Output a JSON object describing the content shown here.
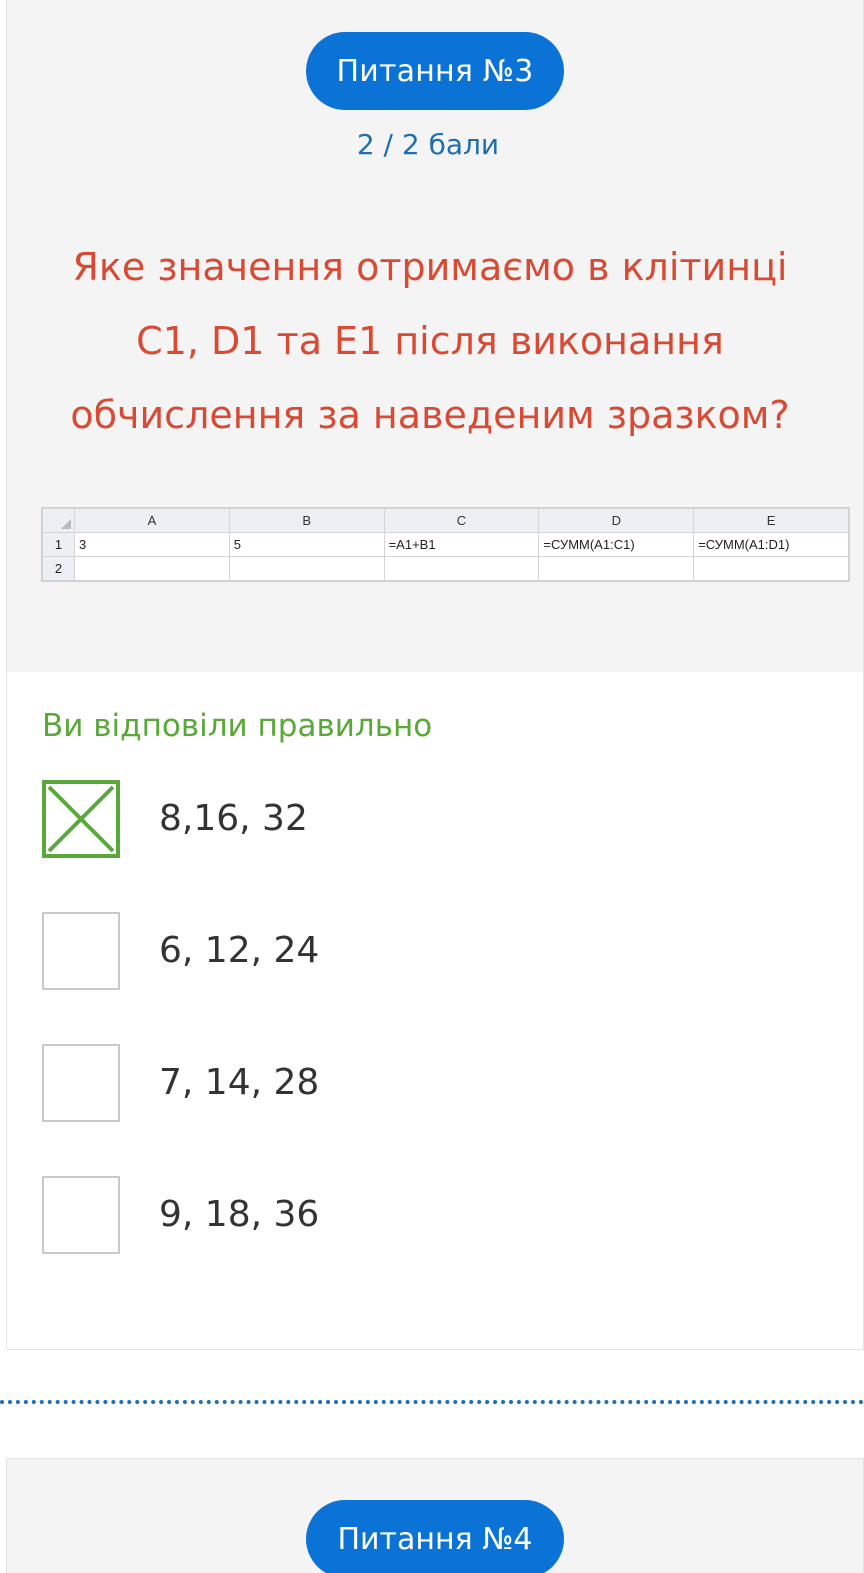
{
  "question": {
    "number_label": "Питання №3",
    "score": "2 / 2 бали",
    "lines": [
      "Яке значення отримаємо в клітинці",
      "С1, D1 та Е1 після виконання",
      "обчислення за наведеним зразком?"
    ]
  },
  "spreadsheet": {
    "columns": [
      "A",
      "B",
      "C",
      "D",
      "E"
    ],
    "rows": [
      {
        "num": "1",
        "cells": [
          "3",
          "5",
          "=A1+B1",
          "=СУММ(A1:C1)",
          "=СУММ(A1:D1)"
        ]
      },
      {
        "num": "2",
        "cells": [
          "",
          "",
          "",
          "",
          ""
        ]
      }
    ]
  },
  "result_text": "Ви відповіли правильно",
  "options": [
    {
      "label": "8,16, 32",
      "checked": true
    },
    {
      "label": "6, 12, 24",
      "checked": false
    },
    {
      "label": "7, 14, 28",
      "checked": false
    },
    {
      "label": "9, 18, 36",
      "checked": false
    }
  ],
  "next_question": {
    "number_label": "Питання №4"
  },
  "colors": {
    "accent": "#0b73d6",
    "question_text": "#d84a33",
    "correct": "#5aa83a",
    "score_text": "#1f6fb0"
  }
}
